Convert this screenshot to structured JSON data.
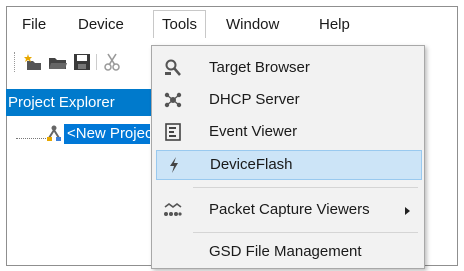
{
  "menubar": {
    "items": [
      {
        "label": "File"
      },
      {
        "label": "Device"
      },
      {
        "label": "Tools"
      },
      {
        "label": "Window"
      },
      {
        "label": "Help"
      }
    ]
  },
  "toolbar": {
    "icons": [
      "new-project-icon",
      "open-folder-icon",
      "save-icon",
      "cut-icon"
    ]
  },
  "project_explorer": {
    "title": "Project Explorer",
    "tree_item": "<New Project>"
  },
  "tools_menu": {
    "items": [
      {
        "label": "Target Browser",
        "icon": "target-browser-icon"
      },
      {
        "label": "DHCP Server",
        "icon": "dhcp-server-icon"
      },
      {
        "label": "Event Viewer",
        "icon": "event-viewer-icon"
      },
      {
        "label": "DeviceFlash",
        "icon": "lightning-icon",
        "highlighted": true
      },
      {
        "label": "Packet Capture Viewers",
        "icon": "packet-capture-icon",
        "submenu": true
      },
      {
        "label": "GSD File Management",
        "icon": ""
      }
    ]
  },
  "colors": {
    "accent": "#007acc",
    "highlight": "#cce4f7",
    "menu_bg": "#f2f2f2"
  }
}
